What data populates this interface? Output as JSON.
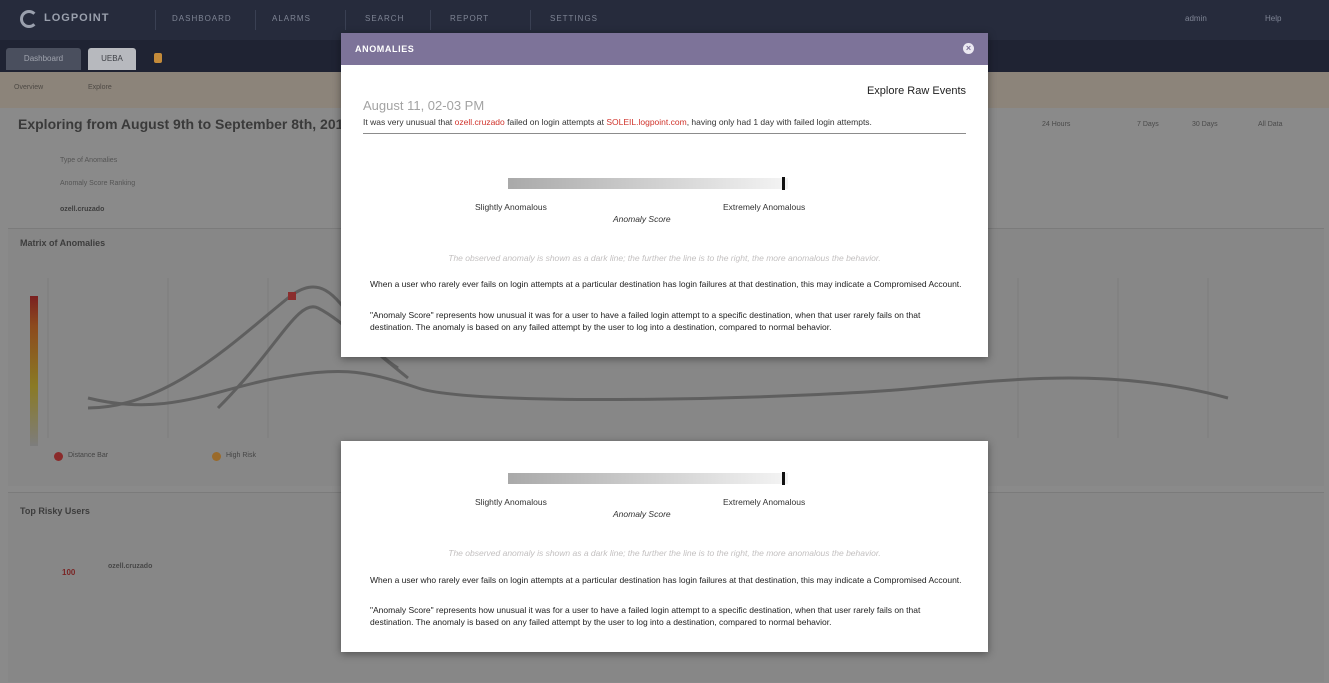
{
  "background": {
    "logo_text": "LOGPOINT",
    "nav_items": [
      "DASHBOARD",
      "ALARMS",
      "SEARCH",
      "REPORT",
      "SETTINGS"
    ],
    "top_right": [
      "admin",
      "Help"
    ],
    "tabs": [
      "Dashboard",
      "UEBA"
    ],
    "sub_items": [
      "Overview",
      "Explore"
    ],
    "page_title": "Exploring from August 9th to September 8th, 2019",
    "range_options": [
      "24 Hours",
      "7 Days",
      "30 Days",
      "All Data"
    ],
    "side_lines": [
      "Type of Anomalies",
      "Anomaly Score Ranking",
      "ozell.cruzado"
    ],
    "matrix_title": "Matrix of Anomalies",
    "risky_title": "Top Risky Users",
    "legend": [
      "Distance Bar",
      "High Risk"
    ],
    "risk_user": "ozell.cruzado",
    "risk_score": "100"
  },
  "modal": {
    "title": "ANOMALIES",
    "close_label": "×",
    "explore_label": "Explore Raw Events",
    "date": "August 11, 02-03 PM",
    "summary_prefix": "It was very unusual that ",
    "summary_user": "ozell.cruzado",
    "summary_mid": " failed on login attempts at ",
    "summary_host": "SOLEIL.logpoint.com",
    "summary_suffix": ", having only had 1 day with failed login attempts.",
    "gauge_left": "Slightly Anomalous",
    "gauge_right": "Extremely Anomalous",
    "gauge_caption": "Anomaly Score",
    "gauge_value": 0.99,
    "hint": "The observed anomaly is shown as a dark line; the further the line is to the right, the more anomalous the behavior.",
    "paragraph_1": "When a user who rarely ever fails on login attempts at a particular destination has login failures at that destination, this may indicate a Compromised Account.",
    "paragraph_2": "\"Anomaly Score\" represents how unusual it was for a user to have a failed login attempt to a specific destination, when that user rarely fails on that destination. The anomaly is based on any failed attempt by the user to log into a destination, compared to normal behavior."
  },
  "colors": {
    "header": "#7d7399",
    "highlight": "#d0342c",
    "topbar": "#262b3c"
  }
}
